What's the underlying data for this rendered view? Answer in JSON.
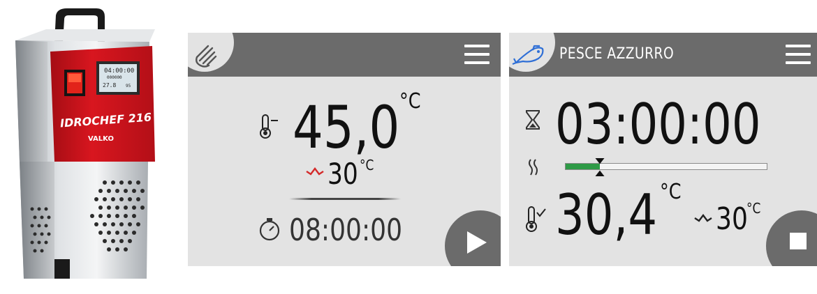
{
  "device": {
    "lcd_time": "04:00:00",
    "lcd_small": "000000",
    "lcd_temp": "27.8",
    "lcd_set": "95",
    "model_name": "IDROCHEF 216",
    "brand": "VALKO"
  },
  "screen_manual": {
    "mode_icon": "hand-icon",
    "temperature": "45,0",
    "temperature_unit": "°C",
    "setpoint": "30",
    "setpoint_unit": "°C",
    "timer": "08:00:00",
    "action": "play"
  },
  "screen_program": {
    "program_icon": "fish-icon",
    "program_name": "PESCE AZZURRO",
    "remaining_time": "03:00:00",
    "progress_fraction": 0.17,
    "current_temperature": "30,4",
    "current_temperature_unit": "°C",
    "setpoint": "30",
    "setpoint_unit": "°C",
    "action": "stop"
  },
  "colors": {
    "bar": "#6b6b6b",
    "screen_bg": "#e3e3e3",
    "accent_red": "#d42a2a",
    "progress_green": "#2e9a46",
    "fish_blue": "#2f6fd6",
    "device_red": "#c8131c"
  }
}
